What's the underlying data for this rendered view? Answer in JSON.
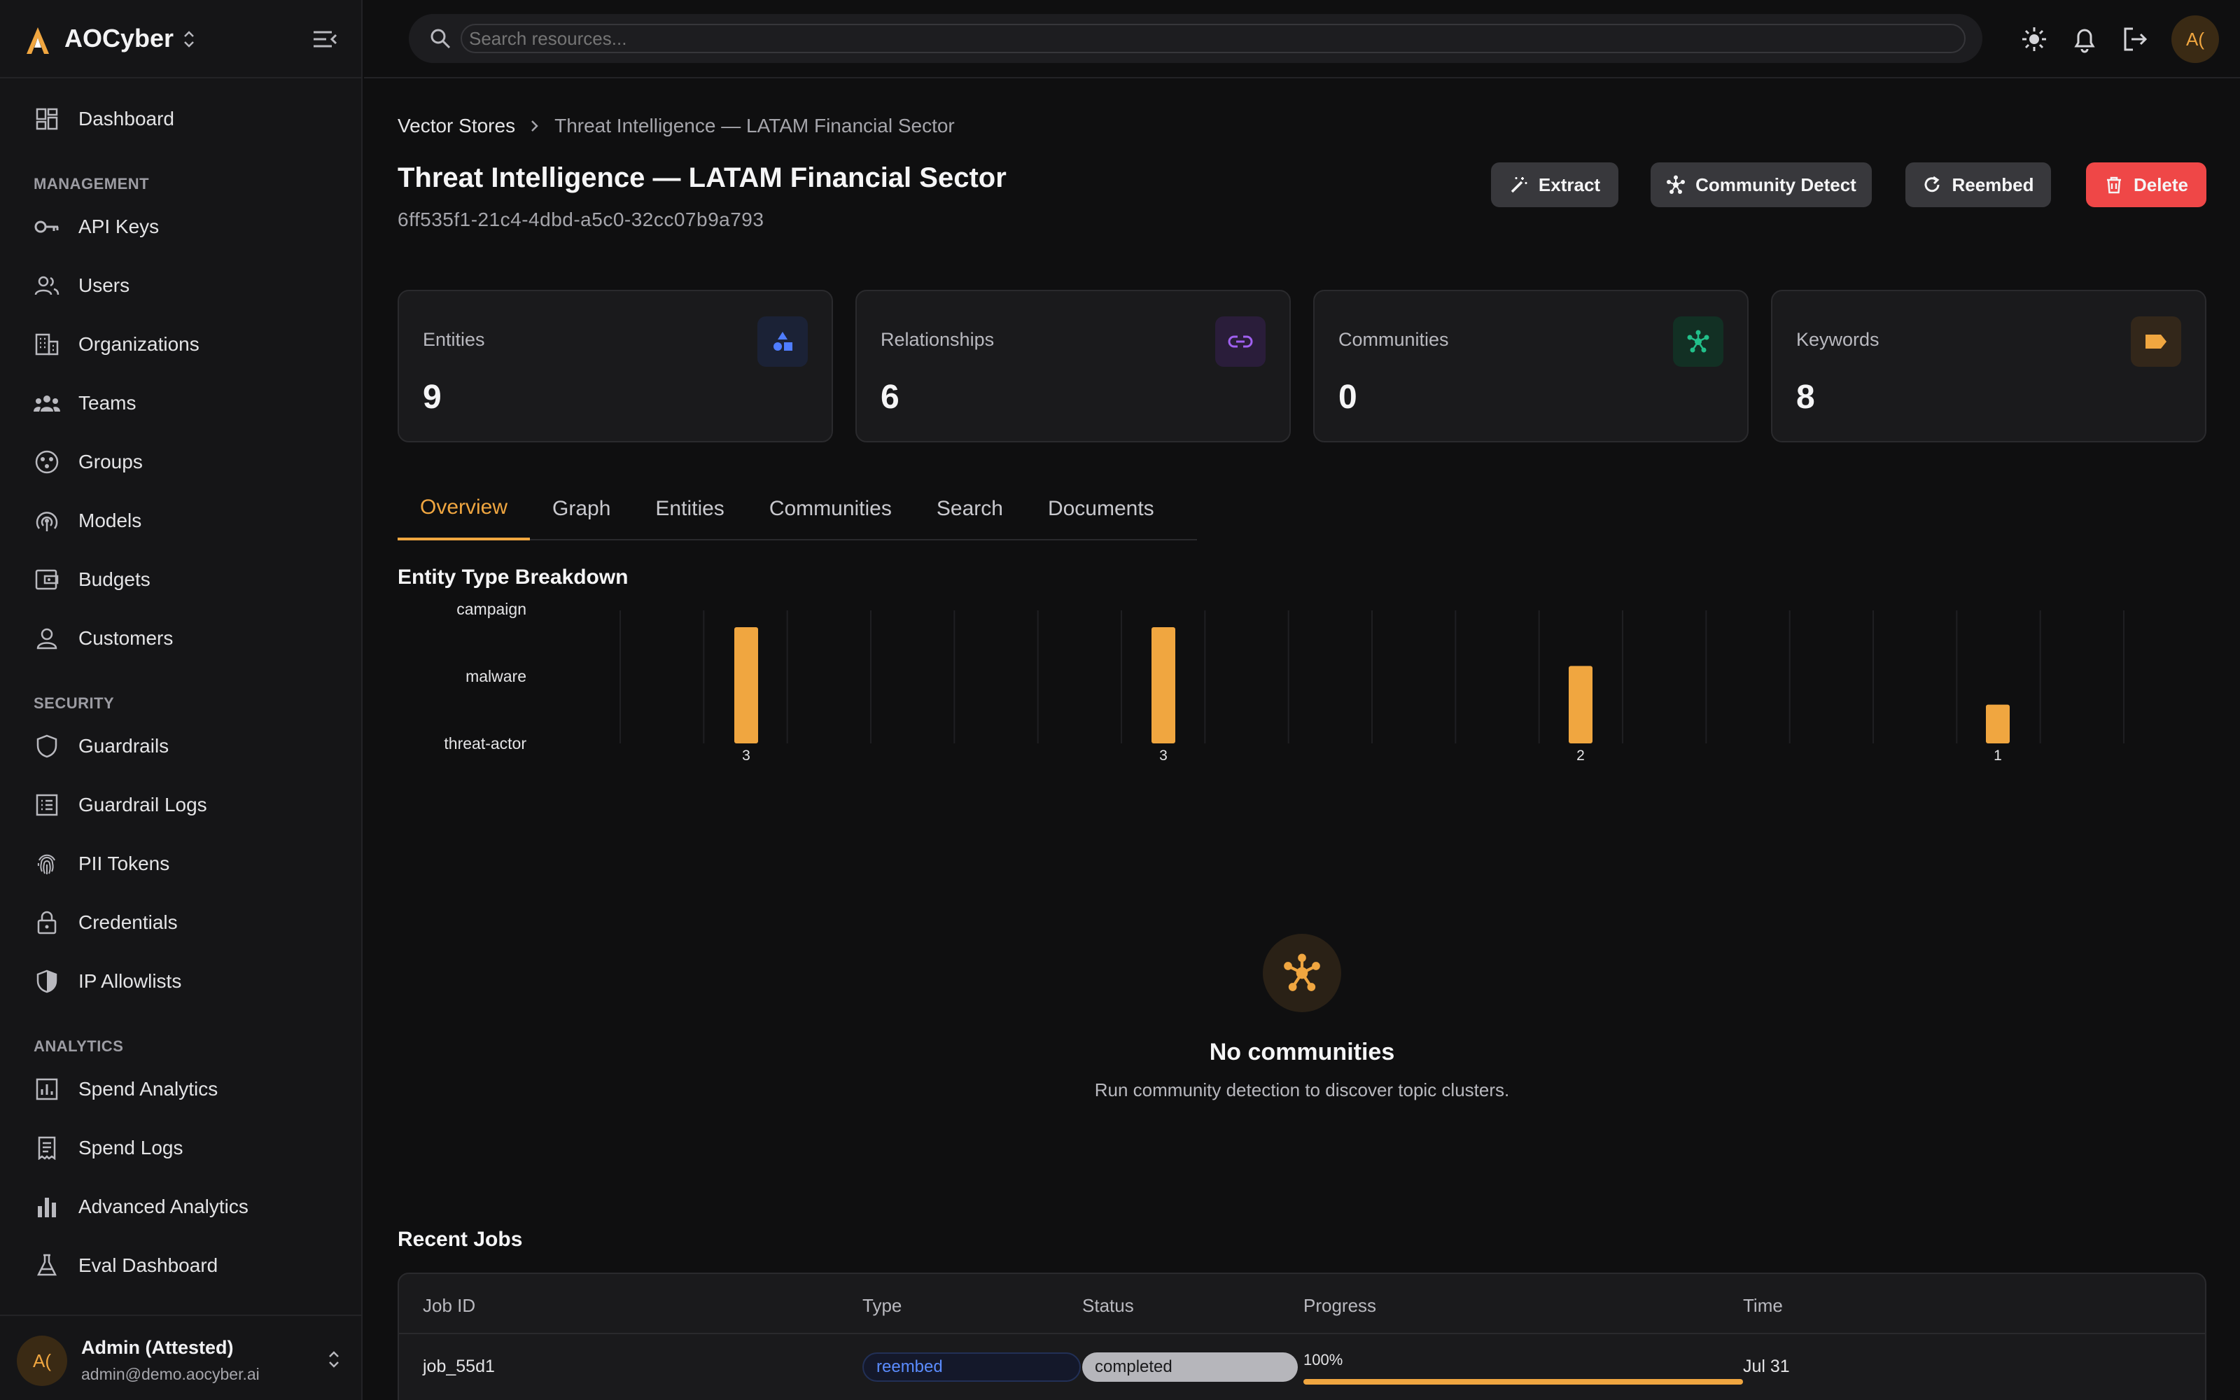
{
  "brand": {
    "name": "AOCyber"
  },
  "sidebar": {
    "top_item": {
      "label": "Dashboard",
      "icon": "dashboard-icon"
    },
    "sections": [
      {
        "title": "MANAGEMENT",
        "items": [
          {
            "label": "API Keys",
            "icon": "key-icon"
          },
          {
            "label": "Users",
            "icon": "users-icon"
          },
          {
            "label": "Organizations",
            "icon": "building-icon"
          },
          {
            "label": "Teams",
            "icon": "team-icon"
          },
          {
            "label": "Groups",
            "icon": "groups-icon"
          },
          {
            "label": "Models",
            "icon": "model-icon"
          },
          {
            "label": "Budgets",
            "icon": "wallet-icon"
          },
          {
            "label": "Customers",
            "icon": "customer-icon"
          }
        ]
      },
      {
        "title": "SECURITY",
        "items": [
          {
            "label": "Guardrails",
            "icon": "shield-icon"
          },
          {
            "label": "Guardrail Logs",
            "icon": "log-icon"
          },
          {
            "label": "PII Tokens",
            "icon": "fingerprint-icon"
          },
          {
            "label": "Credentials",
            "icon": "lock-icon"
          },
          {
            "label": "IP Allowlists",
            "icon": "shield-half-icon"
          }
        ]
      },
      {
        "title": "ANALYTICS",
        "items": [
          {
            "label": "Spend Analytics",
            "icon": "analytics-icon"
          },
          {
            "label": "Spend Logs",
            "icon": "receipt-icon"
          },
          {
            "label": "Advanced Analytics",
            "icon": "bar-chart-icon"
          },
          {
            "label": "Eval Dashboard",
            "icon": "flask-icon"
          }
        ]
      }
    ],
    "user": {
      "initials": "A(",
      "name": "Admin (Attested)",
      "email": "admin@demo.aocyber.ai"
    }
  },
  "topbar": {
    "search_placeholder": "Search resources...",
    "avatar_initials": "A("
  },
  "breadcrumb": {
    "parent": "Vector Stores",
    "current": "Threat Intelligence — LATAM Financial Sector"
  },
  "page": {
    "title": "Threat Intelligence — LATAM Financial Sector",
    "id": "6ff535f1-21c4-4dbd-a5c0-32cc07b9a793"
  },
  "actions": {
    "extract": "Extract",
    "community_detect": "Community Detect",
    "reembed": "Reembed",
    "delete": "Delete"
  },
  "stats": [
    {
      "label": "Entities",
      "value": "9",
      "icon": "shapes-icon",
      "color": "#4f7dff"
    },
    {
      "label": "Relationships",
      "value": "6",
      "icon": "link-icon",
      "color": "#a060f0"
    },
    {
      "label": "Communities",
      "value": "0",
      "icon": "hub-icon",
      "color": "#22c08a"
    },
    {
      "label": "Keywords",
      "value": "8",
      "icon": "tag-icon",
      "color": "#f0a640"
    }
  ],
  "tabs": [
    "Overview",
    "Graph",
    "Entities",
    "Communities",
    "Search",
    "Documents"
  ],
  "active_tab": "Overview",
  "chart_title": "Entity Type Breakdown",
  "chart_data": {
    "type": "bar",
    "title": "Entity Type Breakdown",
    "y_categories": [
      "campaign",
      "malware",
      "threat-actor"
    ],
    "values": [
      3,
      3,
      2,
      1
    ],
    "value_labels": [
      "3",
      "3",
      "2",
      "1"
    ],
    "ylim": [
      0,
      3
    ],
    "grid": true,
    "bar_color": "#f0a640"
  },
  "empty_state": {
    "title": "No communities",
    "subtitle": "Run community detection to discover topic clusters."
  },
  "jobs": {
    "title": "Recent Jobs",
    "columns": [
      "Job ID",
      "Type",
      "Status",
      "Progress",
      "Time"
    ],
    "rows": [
      {
        "job_id": "job_55d1",
        "type": "reembed",
        "status": "completed",
        "progress_label": "100%",
        "progress": 1.0,
        "time": "Jul 31"
      }
    ]
  },
  "colors": {
    "accent": "#f0a640",
    "danger": "#ef4747",
    "background": "#0f0f10"
  }
}
